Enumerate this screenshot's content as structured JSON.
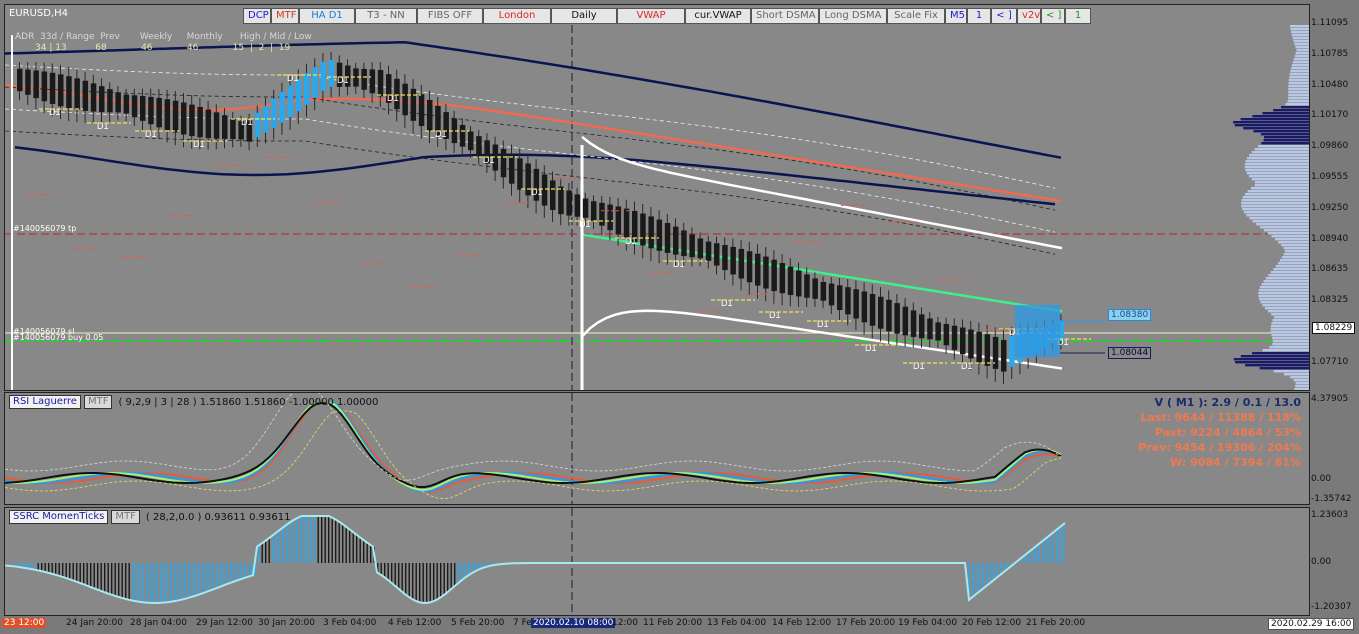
{
  "chart": {
    "symbol": "EURUSD,H4",
    "toolbar": [
      {
        "label": "DCP",
        "color": "#1a1ad8"
      },
      {
        "label": "MTF",
        "color": "#d83a1a"
      },
      {
        "label": "HA D1",
        "color": "#1a7ad8"
      },
      {
        "label": "T3 - NN",
        "color": "#666666"
      },
      {
        "label": "FIBS OFF",
        "color": "#666666"
      },
      {
        "label": "London",
        "color": "#d82a2a"
      },
      {
        "label": "Daily",
        "color": "#111111"
      },
      {
        "label": "VWAP",
        "color": "#d82a2a"
      },
      {
        "label": "cur.VWAP",
        "color": "#111111"
      },
      {
        "label": "Short DSMA",
        "color": "#666666"
      },
      {
        "label": "Long DSMA",
        "color": "#666666"
      },
      {
        "label": "Scale Fix",
        "color": "#666666"
      },
      {
        "label": "M5",
        "color": "#1a1ad8"
      },
      {
        "label": "1",
        "color": "#1a1ad8"
      },
      {
        "label": "< ]",
        "color": "#1a1ad8"
      },
      {
        "label": "v2v",
        "color": "#d82a2a"
      },
      {
        "label": "< ]",
        "color": "#1a9a1a"
      },
      {
        "label": "1",
        "color": "#1a9a1a"
      }
    ],
    "adr_labels": "ADR  33d / Range  Prev       Weekly     Monthly      High / Mid / Low",
    "adr_values": "       34 | 13          68            46            46            15  |  2  |  19",
    "price_axis": [
      "1.11095",
      "1.10785",
      "1.10480",
      "1.10170",
      "1.09860",
      "1.09555",
      "1.09250",
      "1.08940",
      "1.08635",
      "1.08325",
      "1.08020",
      "1.07710"
    ],
    "current_price": "1.08229",
    "box_high": "1.08380",
    "box_low": "1.08044",
    "trade_tp": "#140056079 tp",
    "trade_sl": "#140056079 sl",
    "trade_buy": "#140056079 buy 0.05"
  },
  "rsi": {
    "title": "RSI Laguerre",
    "mtf": "MTF",
    "params": "( 9,2,9 | 3 | 28 ) 1.51860 1.51860 -1.00000 1.00000",
    "axis": [
      "4.37905",
      "0.00",
      "-1.35742"
    ],
    "stats": {
      "v": "V ( M1 ): 2.9 / 0.1 / 13.0",
      "last": "Last: 9644 / 11388 / 118%",
      "past": "Past: 9224 / 4864 / 53%",
      "prev": "Prev: 9454 / 19306 / 204%",
      "w": "W: 9084 / 7394 / 81%"
    }
  },
  "momentum": {
    "title": "SSRC MomenTicks",
    "mtf": "MTF",
    "params": "( 28,2,0.0 ) 0.93611 0.93611",
    "axis": [
      "1.23603",
      "0.00",
      "-1.20307"
    ]
  },
  "time_axis": {
    "start_highlight": "23 12:00",
    "labels": [
      "24 Jan 20:00",
      "28 Jan 04:00",
      "29 Jan 12:00",
      "30 Jan 20:00",
      "3 Feb 04:00",
      "4 Feb 12:00",
      "5 Feb 20:00",
      "7 Fe",
      "12:00",
      "11 Feb 20:00",
      "13 Feb 04:00",
      "14 Feb 12:00",
      "17 Feb 20:00",
      "19 Feb 04:00",
      "20 Feb 12:00",
      "21 Feb 20:00"
    ],
    "cursor_time": "2020.02.10 08:00",
    "end_time": "2020.02.29 16:00"
  },
  "colors": {
    "ema": "#f26a4f",
    "band_navy": "#0a1450",
    "vwap_green": "#3ff08a",
    "ha_blue": "#2aa8ee",
    "histo_black": "#1a1a1a",
    "cursor_highlight": "#1a2a7a",
    "start_highlight": "#e0502a"
  }
}
